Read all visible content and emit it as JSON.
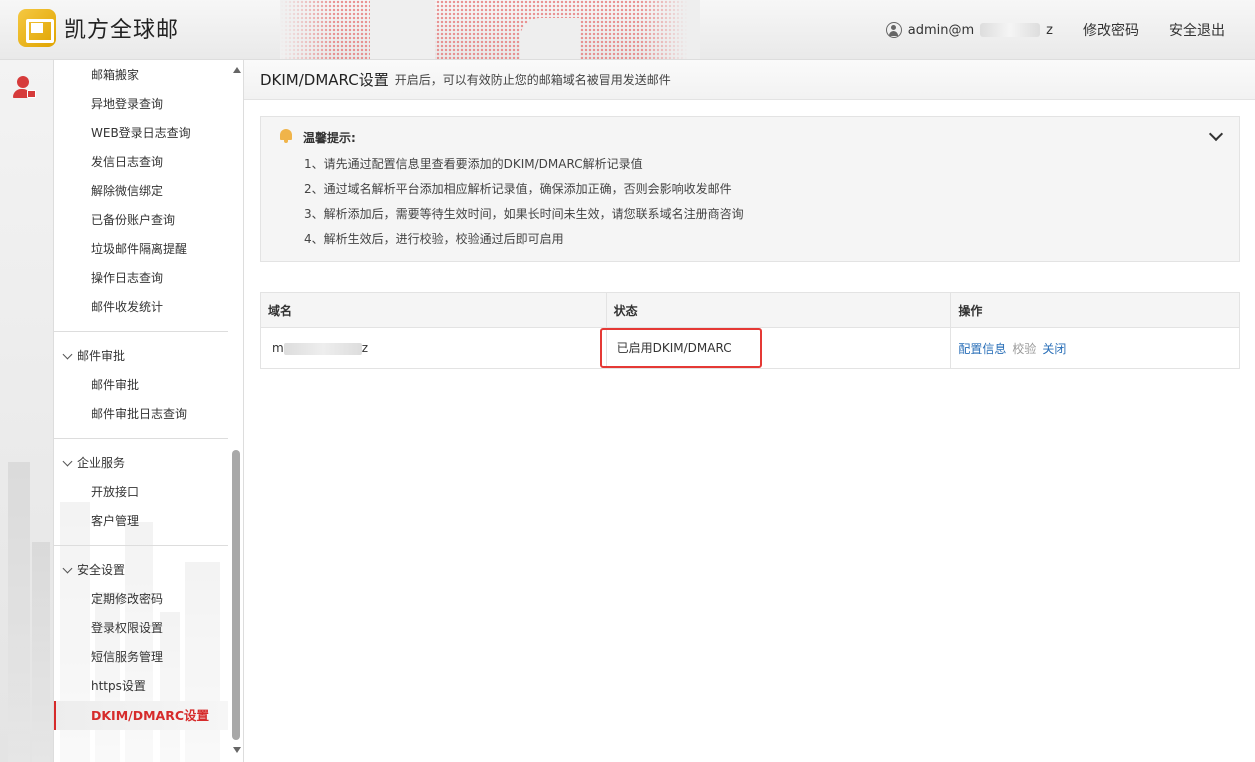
{
  "header": {
    "logo_text": "凯方全球邮",
    "user_prefix": "admin@m",
    "user_suffix": "z",
    "change_password": "修改密码",
    "logout": "安全退出"
  },
  "sidebar": {
    "top_items": [
      "邮箱搬家",
      "异地登录查询",
      "WEB登录日志查询",
      "发信日志查询",
      "解除微信绑定",
      "已备份账户查询",
      "垃圾邮件隔离提醒",
      "操作日志查询",
      "邮件收发统计"
    ],
    "groups": [
      {
        "label": "邮件审批",
        "items": [
          "邮件审批",
          "邮件审批日志查询"
        ]
      },
      {
        "label": "企业服务",
        "items": [
          "开放接口",
          "客户管理"
        ]
      },
      {
        "label": "安全设置",
        "items": [
          "定期修改密码",
          "登录权限设置",
          "短信服务管理",
          "https设置"
        ],
        "active": "DKIM/DMARC设置"
      }
    ]
  },
  "main": {
    "title": "DKIM/DMARC设置",
    "subtitle": "开启后，可以有效防止您的邮箱域名被冒用发送邮件",
    "notice": {
      "title": "温馨提示:",
      "lines": [
        "1、请先通过配置信息里查看要添加的DKIM/DMARC解析记录值",
        "2、通过域名解析平台添加相应解析记录值，确保添加正确，否则会影响收发邮件",
        "3、解析添加后，需要等待生效时间，如果长时间未生效，请您联系域名注册商咨询",
        "4、解析生效后，进行校验，校验通过后即可启用"
      ]
    },
    "table": {
      "headers": [
        "域名",
        "状态",
        "操作"
      ],
      "rows": [
        {
          "domain_prefix": "m",
          "domain_suffix": "z",
          "status": "已启用DKIM/DMARC",
          "actions": [
            "配置信息",
            "校验",
            "关闭"
          ]
        }
      ]
    }
  },
  "colors": {
    "accent_red": "#d62b2b",
    "link_blue": "#2a6fb8",
    "highlight_box": "#e53935",
    "bell": "#f0b44a"
  }
}
